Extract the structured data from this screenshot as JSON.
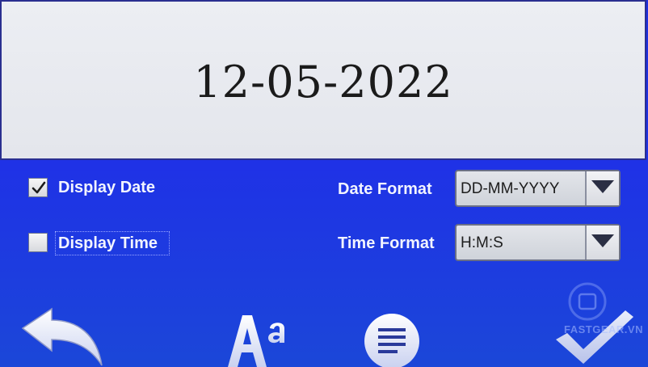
{
  "preview": {
    "text": "12-05-2022"
  },
  "display_date": {
    "label": "Display Date",
    "checked": true
  },
  "display_time": {
    "label": "Display Time",
    "checked": false
  },
  "date_format": {
    "label": "Date Format",
    "value": "DD-MM-YYYY"
  },
  "time_format": {
    "label": "Time Format",
    "value": "H:M:S"
  },
  "toolbar": {
    "back_icon": "back-arrow-icon",
    "font_icon": "font-size-icon",
    "align_icon": "text-align-icon",
    "confirm_icon": "checkmark-icon"
  },
  "watermark": {
    "text": "FASTGEAR.VN"
  },
  "colors": {
    "background": "#1f32e6",
    "preview_bg": "#e4e6ec",
    "label_text": "#f2f4ff"
  }
}
